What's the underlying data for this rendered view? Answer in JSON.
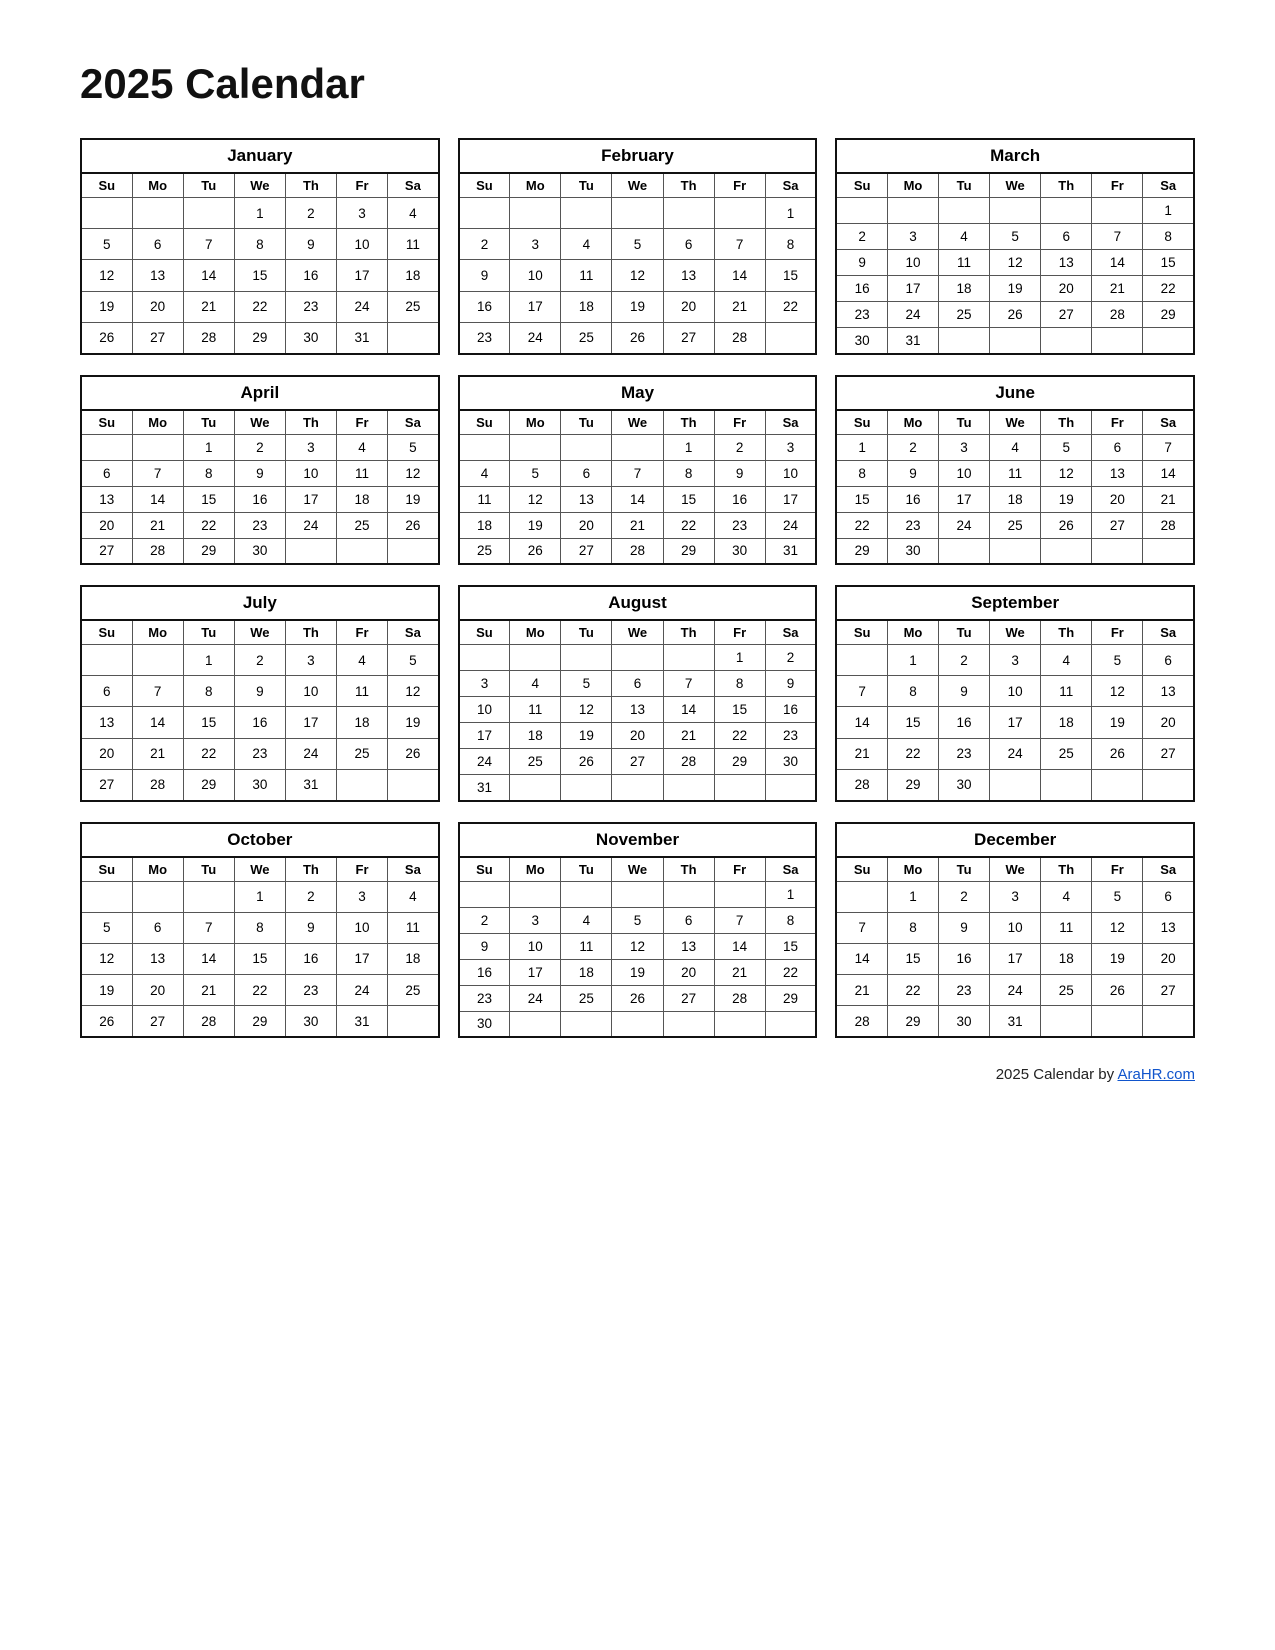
{
  "title": "2025 Calendar",
  "footer": {
    "text": "2025  Calendar by ",
    "link_label": "AraHR.com",
    "link_url": "AraHR.com"
  },
  "months": [
    {
      "name": "January",
      "weeks": [
        [
          "",
          "",
          "",
          "1",
          "2",
          "3",
          "4"
        ],
        [
          "5",
          "6",
          "7",
          "8",
          "9",
          "10",
          "11"
        ],
        [
          "12",
          "13",
          "14",
          "15",
          "16",
          "17",
          "18"
        ],
        [
          "19",
          "20",
          "21",
          "22",
          "23",
          "24",
          "25"
        ],
        [
          "26",
          "27",
          "28",
          "29",
          "30",
          "31",
          ""
        ]
      ]
    },
    {
      "name": "February",
      "weeks": [
        [
          "",
          "",
          "",
          "",
          "",
          "",
          "1"
        ],
        [
          "2",
          "3",
          "4",
          "5",
          "6",
          "7",
          "8"
        ],
        [
          "9",
          "10",
          "11",
          "12",
          "13",
          "14",
          "15"
        ],
        [
          "16",
          "17",
          "18",
          "19",
          "20",
          "21",
          "22"
        ],
        [
          "23",
          "24",
          "25",
          "26",
          "27",
          "28",
          ""
        ]
      ]
    },
    {
      "name": "March",
      "weeks": [
        [
          "",
          "",
          "",
          "",
          "",
          "",
          "1"
        ],
        [
          "2",
          "3",
          "4",
          "5",
          "6",
          "7",
          "8"
        ],
        [
          "9",
          "10",
          "11",
          "12",
          "13",
          "14",
          "15"
        ],
        [
          "16",
          "17",
          "18",
          "19",
          "20",
          "21",
          "22"
        ],
        [
          "23",
          "24",
          "25",
          "26",
          "27",
          "28",
          "29"
        ],
        [
          "30",
          "31",
          "",
          "",
          "",
          "",
          ""
        ]
      ]
    },
    {
      "name": "April",
      "weeks": [
        [
          "",
          "",
          "1",
          "2",
          "3",
          "4",
          "5"
        ],
        [
          "6",
          "7",
          "8",
          "9",
          "10",
          "11",
          "12"
        ],
        [
          "13",
          "14",
          "15",
          "16",
          "17",
          "18",
          "19"
        ],
        [
          "20",
          "21",
          "22",
          "23",
          "24",
          "25",
          "26"
        ],
        [
          "27",
          "28",
          "29",
          "30",
          "",
          "",
          ""
        ]
      ]
    },
    {
      "name": "May",
      "weeks": [
        [
          "",
          "",
          "",
          "",
          "1",
          "2",
          "3"
        ],
        [
          "4",
          "5",
          "6",
          "7",
          "8",
          "9",
          "10"
        ],
        [
          "11",
          "12",
          "13",
          "14",
          "15",
          "16",
          "17"
        ],
        [
          "18",
          "19",
          "20",
          "21",
          "22",
          "23",
          "24"
        ],
        [
          "25",
          "26",
          "27",
          "28",
          "29",
          "30",
          "31"
        ]
      ]
    },
    {
      "name": "June",
      "weeks": [
        [
          "1",
          "2",
          "3",
          "4",
          "5",
          "6",
          "7"
        ],
        [
          "8",
          "9",
          "10",
          "11",
          "12",
          "13",
          "14"
        ],
        [
          "15",
          "16",
          "17",
          "18",
          "19",
          "20",
          "21"
        ],
        [
          "22",
          "23",
          "24",
          "25",
          "26",
          "27",
          "28"
        ],
        [
          "29",
          "30",
          "",
          "",
          "",
          "",
          ""
        ]
      ]
    },
    {
      "name": "July",
      "weeks": [
        [
          "",
          "",
          "1",
          "2",
          "3",
          "4",
          "5"
        ],
        [
          "6",
          "7",
          "8",
          "9",
          "10",
          "11",
          "12"
        ],
        [
          "13",
          "14",
          "15",
          "16",
          "17",
          "18",
          "19"
        ],
        [
          "20",
          "21",
          "22",
          "23",
          "24",
          "25",
          "26"
        ],
        [
          "27",
          "28",
          "29",
          "30",
          "31",
          "",
          ""
        ]
      ]
    },
    {
      "name": "August",
      "weeks": [
        [
          "",
          "",
          "",
          "",
          "",
          "1",
          "2"
        ],
        [
          "3",
          "4",
          "5",
          "6",
          "7",
          "8",
          "9"
        ],
        [
          "10",
          "11",
          "12",
          "13",
          "14",
          "15",
          "16"
        ],
        [
          "17",
          "18",
          "19",
          "20",
          "21",
          "22",
          "23"
        ],
        [
          "24",
          "25",
          "26",
          "27",
          "28",
          "29",
          "30"
        ],
        [
          "31",
          "",
          "",
          "",
          "",
          "",
          ""
        ]
      ]
    },
    {
      "name": "September",
      "weeks": [
        [
          "",
          "1",
          "2",
          "3",
          "4",
          "5",
          "6"
        ],
        [
          "7",
          "8",
          "9",
          "10",
          "11",
          "12",
          "13"
        ],
        [
          "14",
          "15",
          "16",
          "17",
          "18",
          "19",
          "20"
        ],
        [
          "21",
          "22",
          "23",
          "24",
          "25",
          "26",
          "27"
        ],
        [
          "28",
          "29",
          "30",
          "",
          "",
          "",
          ""
        ]
      ]
    },
    {
      "name": "October",
      "weeks": [
        [
          "",
          "",
          "",
          "1",
          "2",
          "3",
          "4"
        ],
        [
          "5",
          "6",
          "7",
          "8",
          "9",
          "10",
          "11"
        ],
        [
          "12",
          "13",
          "14",
          "15",
          "16",
          "17",
          "18"
        ],
        [
          "19",
          "20",
          "21",
          "22",
          "23",
          "24",
          "25"
        ],
        [
          "26",
          "27",
          "28",
          "29",
          "30",
          "31",
          ""
        ]
      ]
    },
    {
      "name": "November",
      "weeks": [
        [
          "",
          "",
          "",
          "",
          "",
          "",
          "1"
        ],
        [
          "2",
          "3",
          "4",
          "5",
          "6",
          "7",
          "8"
        ],
        [
          "9",
          "10",
          "11",
          "12",
          "13",
          "14",
          "15"
        ],
        [
          "16",
          "17",
          "18",
          "19",
          "20",
          "21",
          "22"
        ],
        [
          "23",
          "24",
          "25",
          "26",
          "27",
          "28",
          "29"
        ],
        [
          "30",
          "",
          "",
          "",
          "",
          "",
          ""
        ]
      ]
    },
    {
      "name": "December",
      "weeks": [
        [
          "",
          "1",
          "2",
          "3",
          "4",
          "5",
          "6"
        ],
        [
          "7",
          "8",
          "9",
          "10",
          "11",
          "12",
          "13"
        ],
        [
          "14",
          "15",
          "16",
          "17",
          "18",
          "19",
          "20"
        ],
        [
          "21",
          "22",
          "23",
          "24",
          "25",
          "26",
          "27"
        ],
        [
          "28",
          "29",
          "30",
          "31",
          "",
          "",
          ""
        ]
      ]
    }
  ],
  "day_headers": [
    "Su",
    "Mo",
    "Tu",
    "We",
    "Th",
    "Fr",
    "Sa"
  ]
}
